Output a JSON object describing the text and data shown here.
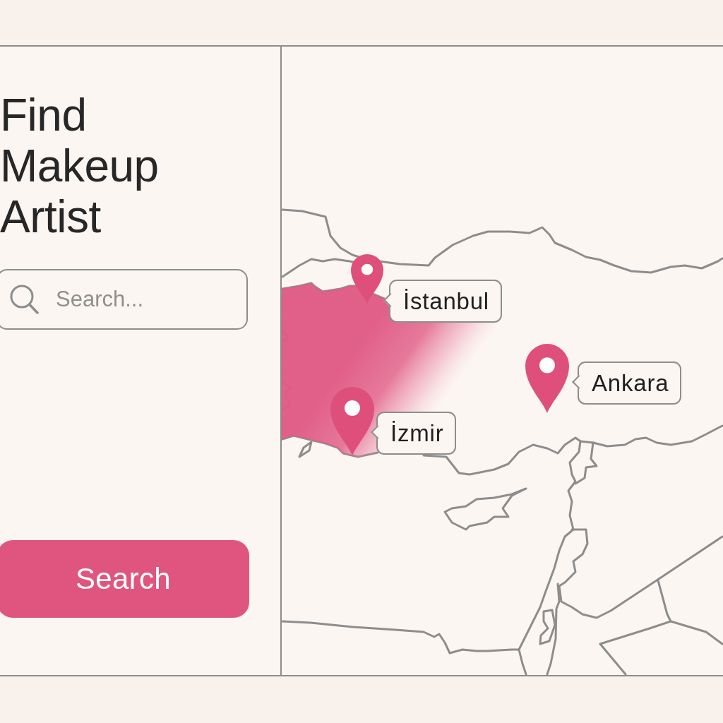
{
  "heading": "Find Makeup Artist",
  "search": {
    "placeholder": "Search..."
  },
  "search_button": {
    "label": "Search"
  },
  "map": {
    "pins": [
      {
        "label": "İstanbul"
      },
      {
        "label": "Ankara"
      },
      {
        "label": "İzmir"
      }
    ]
  }
}
